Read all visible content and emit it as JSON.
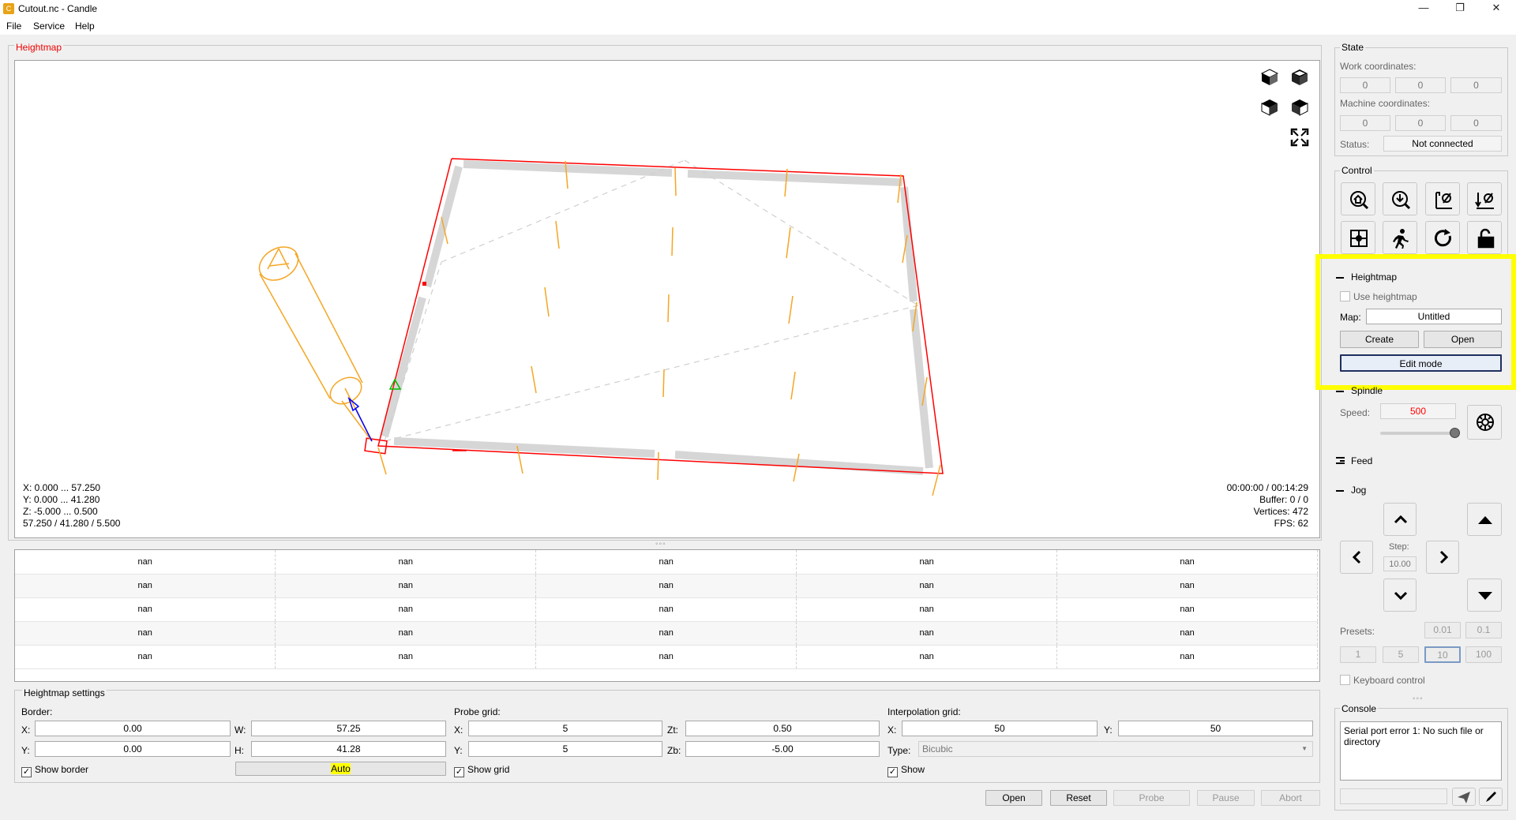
{
  "window": {
    "title": "Cutout.nc - Candle",
    "app_icon": "candle-app-icon"
  },
  "menu": [
    "File",
    "Service",
    "Help"
  ],
  "viewer": {
    "title": "Heightmap",
    "bounds": [
      "X: 0.000 ... 57.250",
      "Y: 0.000 ... 41.280",
      "Z: -5.000 ... 0.500",
      "57.250 / 41.280 / 5.500"
    ],
    "stats": [
      "00:00:00 / 00:14:29",
      "Buffer: 0 / 0",
      "Vertices: 472",
      "FPS: 62"
    ],
    "view_buttons": [
      "iso-view-icon",
      "top-view-icon",
      "front-view-icon",
      "left-view-icon",
      "fit-view-icon"
    ]
  },
  "heightmap_table": {
    "rows": [
      [
        "nan",
        "nan",
        "nan",
        "nan",
        "nan"
      ],
      [
        "nan",
        "nan",
        "nan",
        "nan",
        "nan"
      ],
      [
        "nan",
        "nan",
        "nan",
        "nan",
        "nan"
      ],
      [
        "nan",
        "nan",
        "nan",
        "nan",
        "nan"
      ],
      [
        "nan",
        "nan",
        "nan",
        "nan",
        "nan"
      ]
    ]
  },
  "settings": {
    "title": "Heightmap settings",
    "border_label": "Border:",
    "x_label": "X:",
    "x_value": "0.00",
    "w_label": "W:",
    "w_value": "57.25",
    "y_label": "Y:",
    "y_value": "0.00",
    "h_label": "H:",
    "h_value": "41.28",
    "show_border_label": "Show border",
    "auto_label": "Auto",
    "probe_label": "Probe grid:",
    "probe_x_label": "X:",
    "probe_x": "5",
    "zt_label": "Zt:",
    "zt_value": "0.50",
    "probe_y_label": "Y:",
    "probe_y": "5",
    "zb_label": "Zb:",
    "zb_value": "-5.00",
    "show_grid_label": "Show grid",
    "interp_label": "Interpolation grid:",
    "interp_x_label": "X:",
    "interp_x": "50",
    "interp_y_label": "Y:",
    "interp_y": "50",
    "type_label": "Type:",
    "type_value": "Bicubic",
    "show_label": "Show"
  },
  "bottom_buttons": {
    "open": "Open",
    "reset": "Reset",
    "probe": "Probe",
    "pause": "Pause",
    "abort": "Abort"
  },
  "state": {
    "title": "State",
    "work_label": "Work coordinates:",
    "work": [
      "0",
      "0",
      "0"
    ],
    "machine_label": "Machine coordinates:",
    "machine": [
      "0",
      "0",
      "0"
    ],
    "status_label": "Status:",
    "status_value": "Not connected"
  },
  "control": {
    "title": "Control"
  },
  "heightmap_panel": {
    "title": "Heightmap",
    "use_label": "Use heightmap",
    "map_label": "Map:",
    "map_value": "Untitled",
    "create": "Create",
    "open": "Open",
    "edit_mode": "Edit mode"
  },
  "spindle": {
    "title": "Spindle",
    "speed_label": "Speed:",
    "speed_value": "500",
    "slider_level": 1.0
  },
  "feed": {
    "title": "Feed"
  },
  "jog": {
    "title": "Jog",
    "step_label": "Step:",
    "step_value": "10.00",
    "presets_label": "Presets:",
    "presets_top": [
      "0.01",
      "0.1"
    ],
    "presets_bottom": [
      "1",
      "5",
      "10",
      "100"
    ],
    "keyboard_label": "Keyboard control"
  },
  "console": {
    "title": "Console",
    "text": "Serial port error 1: No such file or directory"
  },
  "colors": {
    "highlight": "#ffff00",
    "toolpath": "#ff0000",
    "probe": "#f5a623",
    "speed": "#ff0000"
  }
}
